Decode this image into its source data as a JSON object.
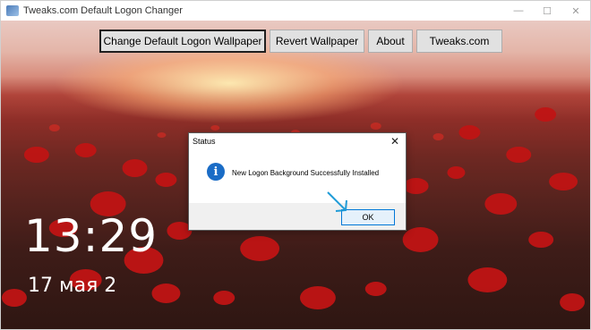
{
  "window": {
    "title": "Tweaks.com Default Logon Changer",
    "controls": [
      "minimize",
      "maximize",
      "close"
    ]
  },
  "toolbar": {
    "change_label": "Change Default Logon Wallpaper",
    "revert_label": "Revert Wallpaper",
    "about_label": "About",
    "tweaks_label": "Tweaks.com"
  },
  "preview": {
    "time": "13:29",
    "date": "17 мая 2"
  },
  "dialog": {
    "title": "Status",
    "message": "New Logon Background Successfully Installed",
    "ok_label": "OK",
    "icon": "info-icon"
  },
  "colors": {
    "accent": "#0078d7",
    "info_icon": "#1a6cc6",
    "pointer": "#1e9bd7"
  }
}
